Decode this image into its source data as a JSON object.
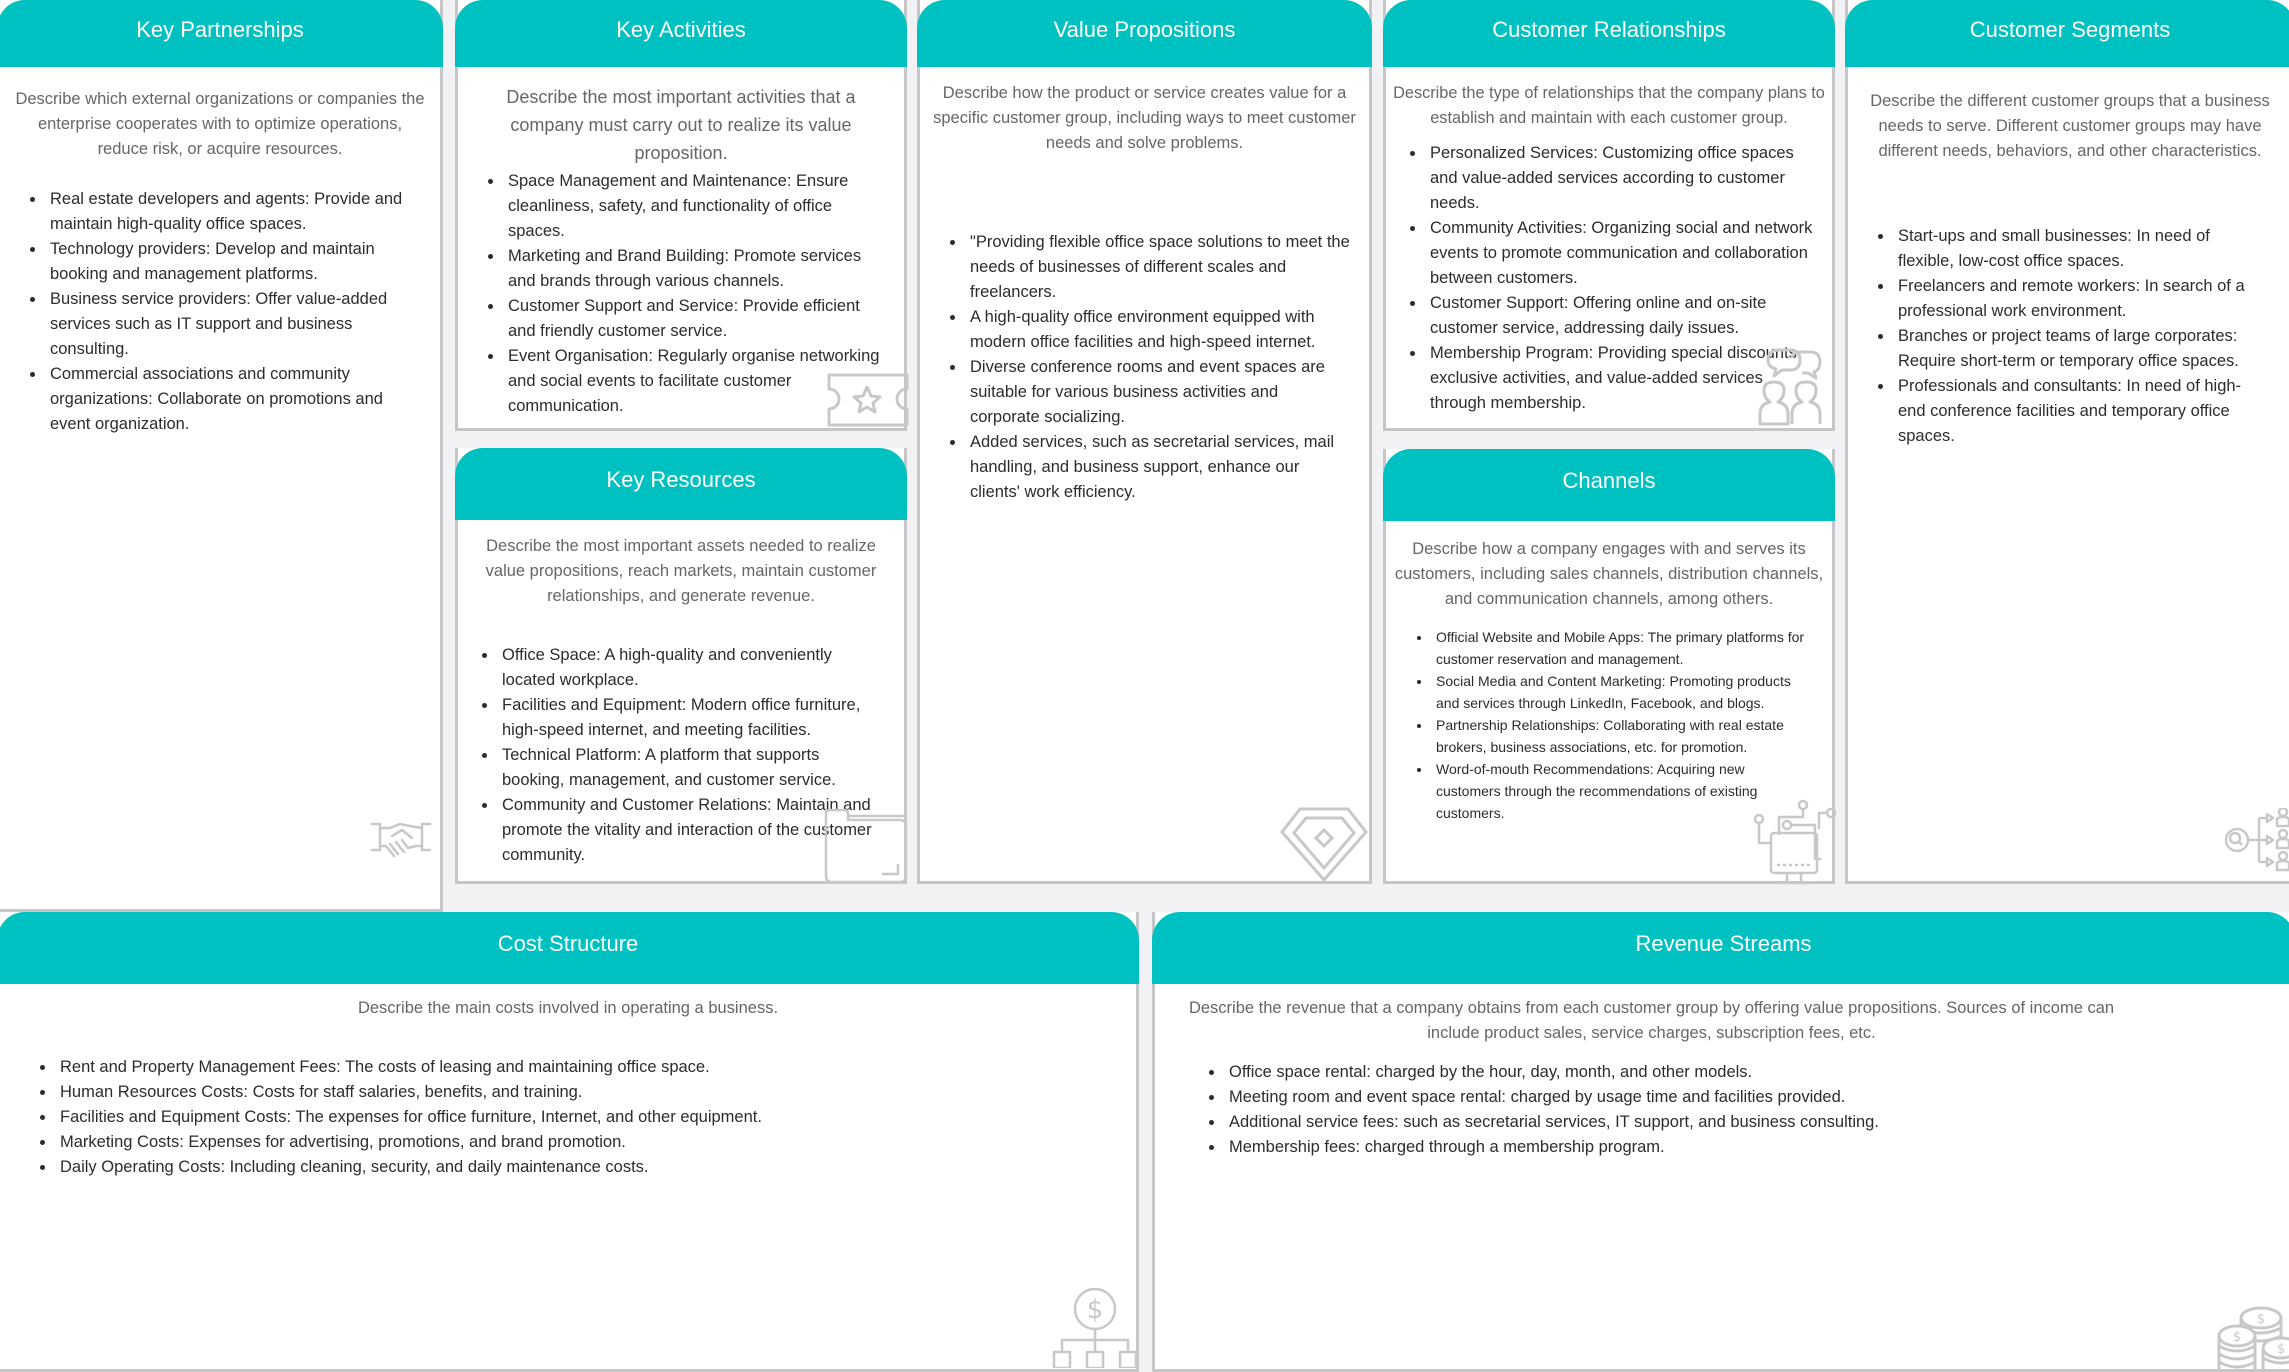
{
  "colors": {
    "header": "#00c1c1",
    "border": "#c6c6c9",
    "background": "#f2f2f4",
    "icon": "#c8c8c8"
  },
  "blocks": {
    "key_partnerships": {
      "title": "Key Partnerships",
      "description": "Describe which external organizations or companies the enterprise cooperates with to optimize operations, reduce risk, or acquire resources.",
      "items": [
        "Real estate developers and agents: Provide and maintain high-quality office spaces.",
        "Technology providers: Develop and maintain booking and management platforms.",
        "Business service providers: Offer value-added services such as IT support and business consulting.",
        "Commercial associations and community organizations: Collaborate on promotions and event organization."
      ],
      "icon": "handshake-icon"
    },
    "key_activities": {
      "title": "Key Activities",
      "description": "Describe the most important activities that a company must carry out to realize its value proposition.",
      "items": [
        "Space Management and Maintenance: Ensure cleanliness, safety, and functionality of office spaces.",
        "Marketing and Brand Building: Promote services and brands through various channels.",
        "Customer Support and Service: Provide efficient and friendly customer service.",
        "Event Organisation: Regularly organise networking and social events to facilitate customer communication."
      ],
      "icon": "star-ticket-icon"
    },
    "key_resources": {
      "title": "Key Resources",
      "description": "Describe the most important assets needed to realize value propositions, reach markets, maintain customer relationships, and generate revenue.",
      "items": [
        "Office Space: A high-quality and conveniently located workplace.",
        "Facilities and Equipment: Modern office furniture, high-speed internet, and meeting facilities.",
        "Technical Platform: A platform that supports booking, management, and customer service.",
        "Community and Customer Relations: Maintain and promote the vitality and interaction of the customer community."
      ],
      "icon": "folder-icon"
    },
    "value_propositions": {
      "title": "Value Propositions",
      "description": "Describe how the product or service creates value for a specific customer group, including ways to meet customer needs and solve problems.",
      "items": [
        "\"Providing flexible office space solutions to meet the needs of businesses of different scales and freelancers.",
        "A high-quality office environment equipped with modern office facilities and high-speed internet.",
        "Diverse conference rooms and event spaces are suitable for various business activities and corporate socializing.",
        "Added services, such as secretarial services, mail handling, and business support, enhance our clients' work efficiency."
      ],
      "icon": "diamond-icon"
    },
    "customer_relationships": {
      "title": "Customer Relationships",
      "description": "Describe the type of relationships that the company plans to establish and maintain with each customer group.",
      "items": [
        "Personalized Services: Customizing office spaces and value-added services according to customer needs.",
        "Community Activities: Organizing social and network events to promote communication and collaboration between customers.",
        "Customer Support: Offering online and on-site customer service, addressing daily issues.",
        "Membership Program: Providing special discounts, exclusive activities, and value-added services through membership."
      ],
      "icon": "people-chat-icon"
    },
    "channels": {
      "title": "Channels",
      "description": "Describe how a company engages with and serves its customers, including sales channels, distribution channels, and communication channels, among others.",
      "items": [
        "Official Website and Mobile Apps: The primary platforms for customer reservation and management.",
        "Social Media and Content Marketing: Promoting products and services through LinkedIn, Facebook, and blogs.",
        "Partnership Relationships: Collaborating with real estate brokers, business associations, etc. for promotion.",
        "Word-of-mouth Recommendations: Acquiring new customers through the recommendations of existing customers."
      ],
      "icon": "network-monitor-icon"
    },
    "customer_segments": {
      "title": "Customer Segments",
      "description": "Describe the different customer groups that a business needs to serve. Different customer groups may have different needs, behaviors, and other characteristics.",
      "items": [
        "Start-ups and small businesses: In need of flexible, low-cost office spaces.",
        "Freelancers and remote workers: In search of a professional work environment.",
        "Branches or project teams of large corporates: Require short-term or temporary office spaces.",
        "Professionals and consultants: In need of high-end conference facilities and temporary office spaces."
      ],
      "icon": "segmentation-icon"
    },
    "cost_structure": {
      "title": "Cost Structure",
      "description": "Describe the main costs involved in operating a business.",
      "items": [
        "Rent and Property Management Fees: The costs of leasing and maintaining office space.",
        "Human Resources Costs: Costs for staff salaries, benefits, and training.",
        "Facilities and Equipment Costs: The expenses for office furniture, Internet, and other equipment.",
        "Marketing Costs: Expenses for advertising, promotions, and brand promotion.",
        "Daily Operating Costs: Including cleaning, security, and daily maintenance costs."
      ],
      "icon": "dollar-hierarchy-icon"
    },
    "revenue_streams": {
      "title": "Revenue Streams",
      "description": "Describe the revenue that a company obtains from each customer group by offering value propositions. Sources of income can include product sales, service charges, subscription fees, etc.",
      "items": [
        "Office space rental: charged by the hour, day, month, and other models.",
        "Meeting room and event space rental: charged by usage time and facilities provided.",
        "Additional service fees: such as secretarial services, IT support, and business consulting.",
        "Membership fees: charged through a membership program."
      ],
      "icon": "coins-icon"
    }
  }
}
